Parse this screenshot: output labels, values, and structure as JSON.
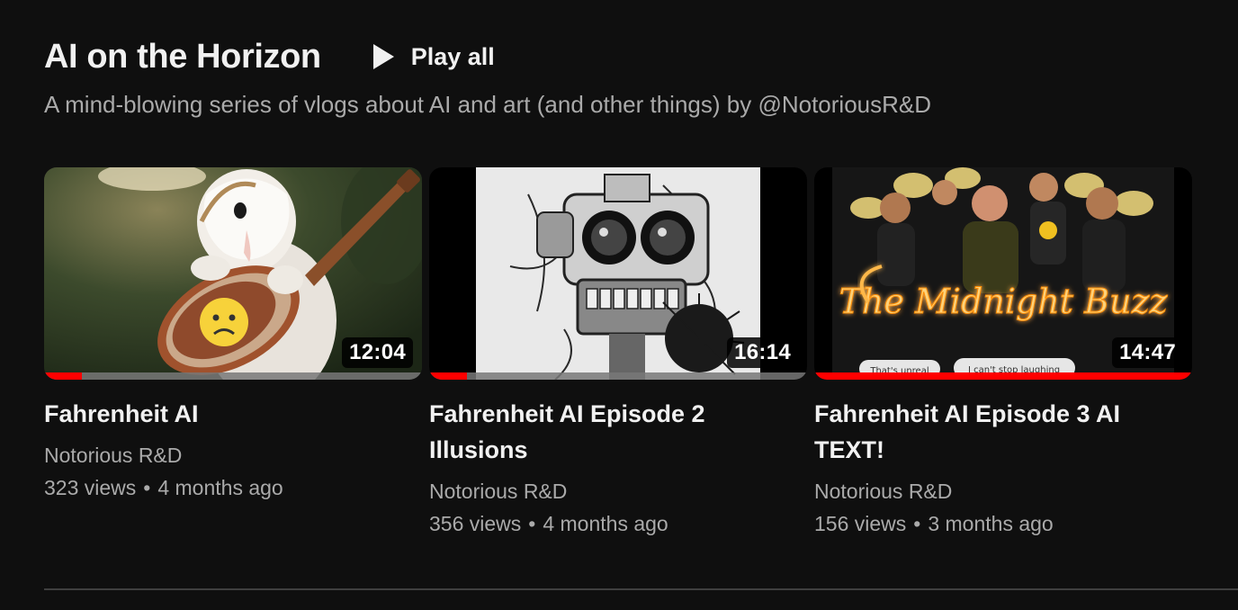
{
  "shelf": {
    "title": "AI on the Horizon",
    "play_all_label": "Play all",
    "description": "A mind-blowing series of vlogs about AI and art (and other things) by @NotoriousR&D"
  },
  "videos": [
    {
      "title": "Fahrenheit AI",
      "channel": "Notorious R&D",
      "views": "323 views",
      "age": "4 months ago",
      "duration": "12:04",
      "watched_fraction": 0.1,
      "thumbnail_icon": "owl-guitar-thumbnail"
    },
    {
      "title": "Fahrenheit AI Episode 2 Illusions",
      "channel": "Notorious R&D",
      "views": "356 views",
      "age": "4 months ago",
      "duration": "16:14",
      "watched_fraction": 0.1,
      "thumbnail_icon": "robot-thumbnail"
    },
    {
      "title": "Fahrenheit AI Episode 3 AI TEXT!",
      "channel": "Notorious R&D",
      "views": "156 views",
      "age": "3 months ago",
      "duration": "14:47",
      "watched_fraction": 1.0,
      "thumbnail_icon": "midnight-buzz-thumbnail",
      "thumbnail_text": {
        "neon": "The Midnight Buzz",
        "bubble_left": "That's unreal",
        "bubble_right": "I can't stop laughing"
      }
    }
  ],
  "colors": {
    "background": "#0f0f0f",
    "progress": "#ff0000",
    "secondary_text": "#aaaaaa",
    "neon": "#ffcc66"
  }
}
